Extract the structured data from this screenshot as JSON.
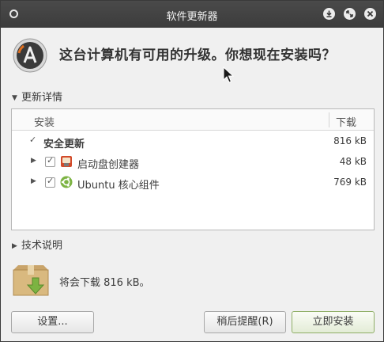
{
  "window": {
    "title": "软件更新器"
  },
  "titlebar_buttons": [
    "minimize-icon",
    "maximize-icon",
    "close-icon"
  ],
  "header": {
    "question": "这台计算机有可用的升级。你想现在安装吗？"
  },
  "details_expander": {
    "label": "更新详情",
    "expanded": true
  },
  "updates_table": {
    "columns": [
      "安装",
      "下载"
    ],
    "rows": [
      {
        "label": "安全更新",
        "size": "816 kB",
        "checked": true,
        "expandable": false,
        "bold": true,
        "level": 0
      },
      {
        "label": "启动盘创建器",
        "size": "48 kB",
        "checked": true,
        "expandable": true,
        "bold": false,
        "level": 1,
        "icon": "usb-creator-icon"
      },
      {
        "label": "Ubuntu 核心组件",
        "size": "769 kB",
        "checked": true,
        "expandable": true,
        "bold": false,
        "level": 1,
        "icon": "ubuntu-logo-icon"
      }
    ]
  },
  "technical_expander": {
    "label": "技术说明",
    "expanded": false
  },
  "download_summary": "将会下载 816 kB。",
  "buttons": {
    "settings": "设置...",
    "remind_later": "稍后提醒(R)",
    "install_now": "立即安装"
  },
  "colors": {
    "titlebar": "#3c3c3c",
    "primary_button_border": "#8fae66",
    "window_bg": "#f0f0f0"
  }
}
